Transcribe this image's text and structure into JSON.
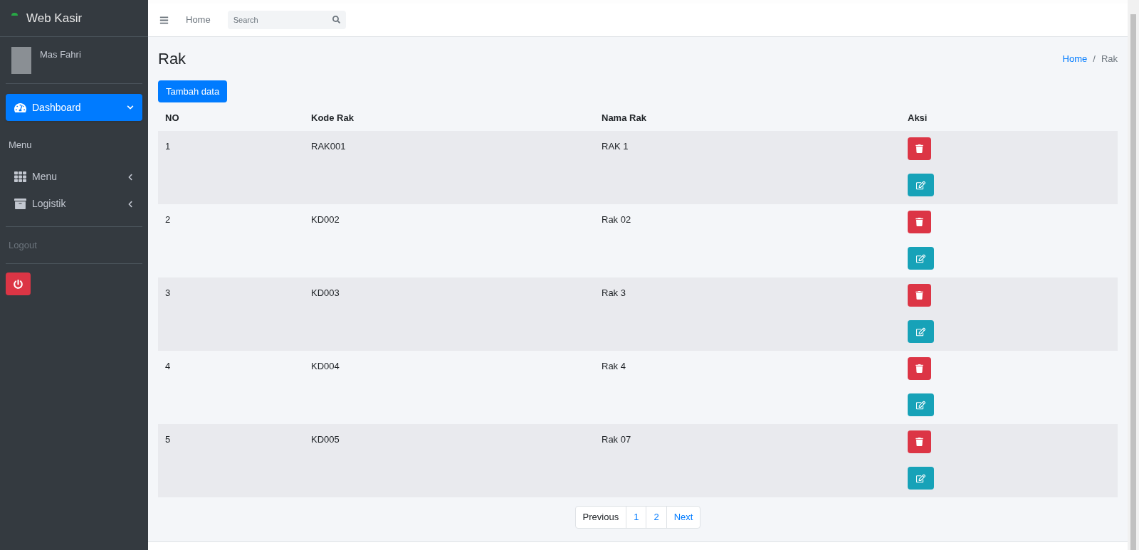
{
  "sidebar": {
    "brand": "Web Kasir",
    "user": {
      "name": "Mas Fahri"
    },
    "items": [
      {
        "kind": "link",
        "label": "Dashboard",
        "selected": true,
        "expanded": true
      },
      {
        "kind": "header",
        "label": "Menu",
        "disabled": false
      },
      {
        "kind": "link",
        "label": "Menu",
        "selected": false,
        "expanded": false
      },
      {
        "kind": "link",
        "label": "Logistik",
        "selected": false,
        "expanded": false
      },
      {
        "kind": "header",
        "label": "Logout",
        "disabled": true
      },
      {
        "kind": "power-button"
      }
    ]
  },
  "navbar": {
    "links": [
      "Home"
    ],
    "search": {
      "placeholder": "Search"
    }
  },
  "page": {
    "title": "Rak",
    "breadcrumb_separator": "/",
    "breadcrumb": [
      {
        "label": "Home",
        "selected": false
      },
      {
        "label": "Rak",
        "selected": true
      }
    ]
  },
  "add_button": "Tambah data",
  "table": {
    "columns": [
      "NO",
      "Kode Rak",
      "Nama Rak",
      "Aksi"
    ],
    "rows": [
      {
        "no": "1",
        "kode": "RAK001",
        "nama": "RAK 1"
      },
      {
        "no": "2",
        "kode": "KD002",
        "nama": "Rak 02"
      },
      {
        "no": "3",
        "kode": "KD003",
        "nama": "Rak 3"
      },
      {
        "no": "4",
        "kode": "KD004",
        "nama": "Rak 4"
      },
      {
        "no": "5",
        "kode": "KD005",
        "nama": "Rak 07"
      }
    ]
  },
  "pagination": [
    {
      "label": "Previous",
      "disabled": true
    },
    {
      "label": "1",
      "disabled": false
    },
    {
      "label": "2",
      "disabled": false
    },
    {
      "label": "Next",
      "disabled": false
    }
  ]
}
